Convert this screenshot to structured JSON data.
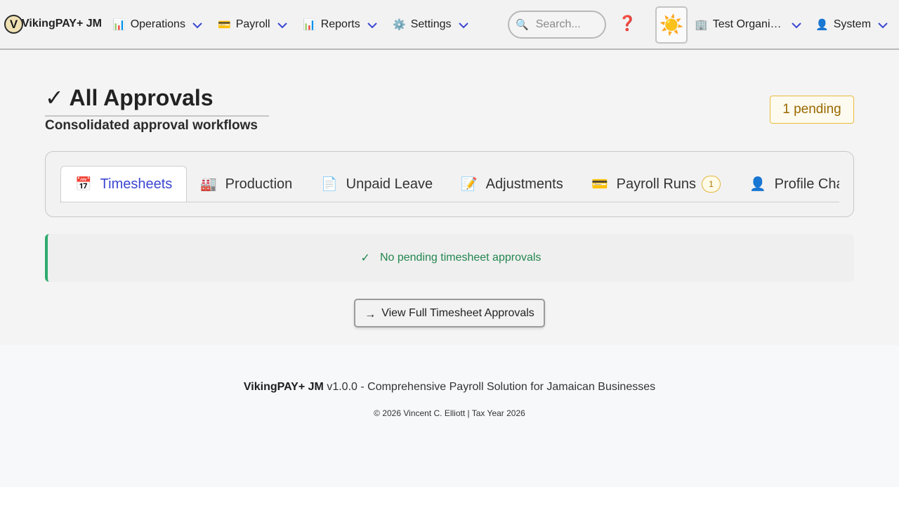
{
  "navbar": {
    "logo_letter": "V",
    "brand": "VikingPAY+ JM",
    "menus": [
      {
        "icon": "📊",
        "icon_name": "bar-chart-icon",
        "label": "Operations"
      },
      {
        "icon": "💳",
        "icon_name": "credit-card-icon",
        "label": "Payroll"
      },
      {
        "icon": "📊",
        "icon_name": "bar-chart-icon",
        "label": "Reports"
      },
      {
        "icon": "⚙️",
        "icon_name": "gear-icon",
        "label": "Settings"
      }
    ],
    "search": {
      "icon": "🔍",
      "placeholder": "Search..."
    },
    "help_icon": "❓",
    "theme_icon": "☀️",
    "organization": {
      "icon": "🏢",
      "label": "Test Organi…"
    },
    "user": {
      "icon": "👤",
      "label": "System"
    },
    "chevron_color": "#3a46d1"
  },
  "page": {
    "title": "✓ All Approvals",
    "subtitle": "Consolidated approval workflows",
    "pending_badge": "1 pending"
  },
  "tabs": [
    {
      "icon": "📅",
      "label": "Timesheets",
      "active": true
    },
    {
      "icon": "🏭",
      "label": "Production"
    },
    {
      "icon": "📄",
      "label": "Unpaid Leave"
    },
    {
      "icon": "📝",
      "label": "Adjustments"
    },
    {
      "icon": "💳",
      "label": "Payroll Runs",
      "count": "1"
    },
    {
      "icon": "👤",
      "label": "Profile Cha"
    }
  ],
  "alert": {
    "icon": "✓",
    "text": "No pending timesheet approvals"
  },
  "view_button": {
    "icon": "→",
    "label": "View Full Timesheet Approvals"
  },
  "footer": {
    "brand": "VikingPAY+ JM",
    "tagline": "v1.0.0 - Comprehensive Payroll Solution for Jamaican Businesses",
    "copyright": "© 2026 Vincent C. Elliott | Tax Year 2026"
  },
  "colors": {
    "accent": "#3a46d1",
    "success": "#2eaa6e",
    "warning": "#e8bd3c"
  }
}
